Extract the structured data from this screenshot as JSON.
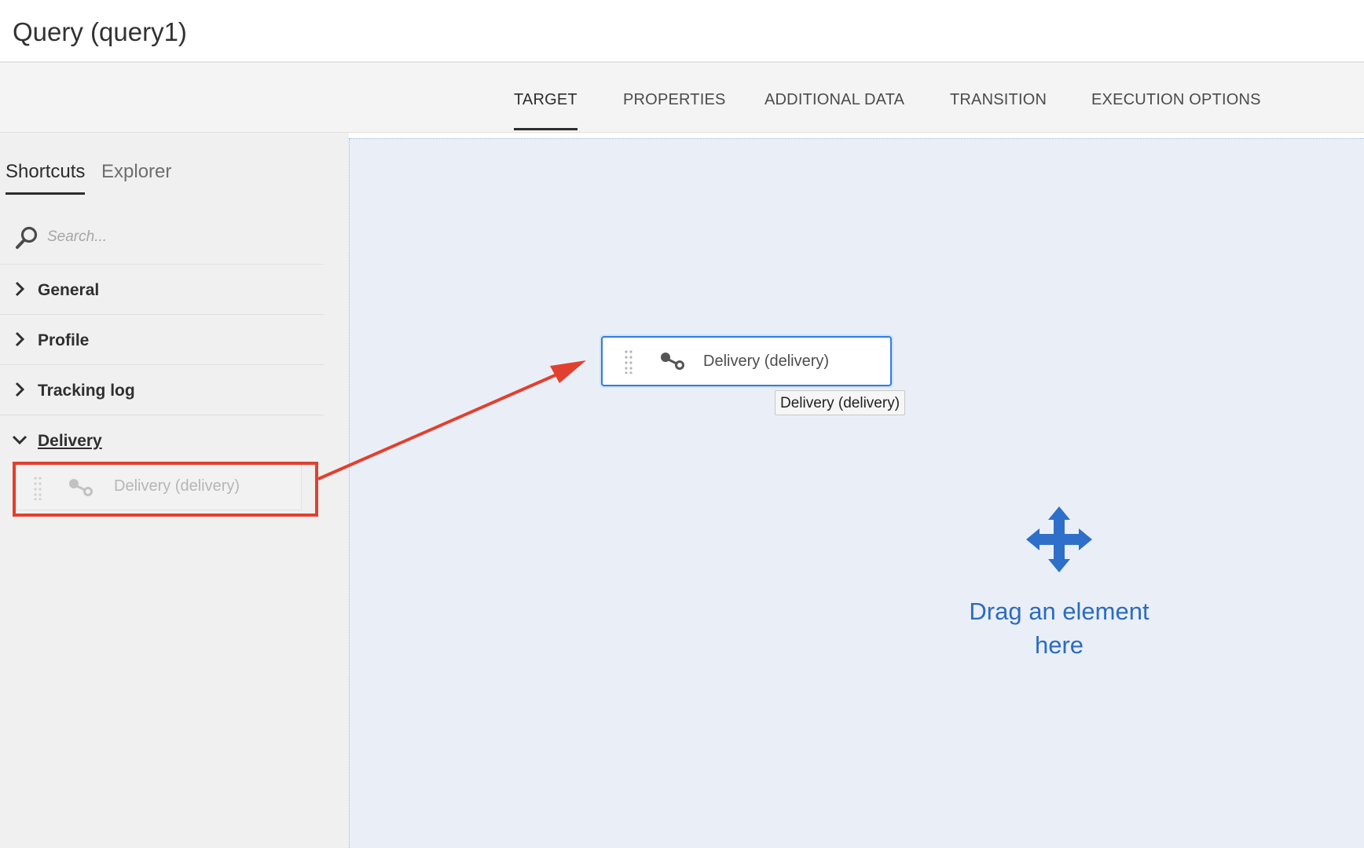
{
  "window": {
    "title": "Query (query1)"
  },
  "tabs": [
    {
      "label": "TARGET",
      "active": true
    },
    {
      "label": "PROPERTIES",
      "active": false
    },
    {
      "label": "ADDITIONAL DATA",
      "active": false
    },
    {
      "label": "TRANSITION",
      "active": false
    },
    {
      "label": "EXECUTION OPTIONS",
      "active": false
    }
  ],
  "sidebar": {
    "tabs": [
      {
        "label": "Shortcuts",
        "active": true
      },
      {
        "label": "Explorer",
        "active": false
      }
    ],
    "search": {
      "placeholder": "Search...",
      "value": ""
    },
    "sections": [
      {
        "label": "General",
        "expanded": false
      },
      {
        "label": "Profile",
        "expanded": false
      },
      {
        "label": "Tracking log",
        "expanded": false
      },
      {
        "label": "Delivery",
        "expanded": true
      }
    ],
    "dragged_item": {
      "label": "Delivery (delivery)",
      "icon": "link-icon"
    }
  },
  "canvas": {
    "node": {
      "label": "Delivery (delivery)",
      "icon": "link-icon"
    },
    "tooltip": "Delivery (delivery)",
    "drop_hint": {
      "line1": "Drag an element",
      "line2": "here",
      "icon": "move-icon"
    }
  },
  "colors": {
    "accent": "#2f7de0",
    "hint_text": "#2b6bc2",
    "annotation": "#e2402f",
    "canvas_bg": "#eaeff7",
    "sidebar_bg": "#f0f0f0"
  }
}
